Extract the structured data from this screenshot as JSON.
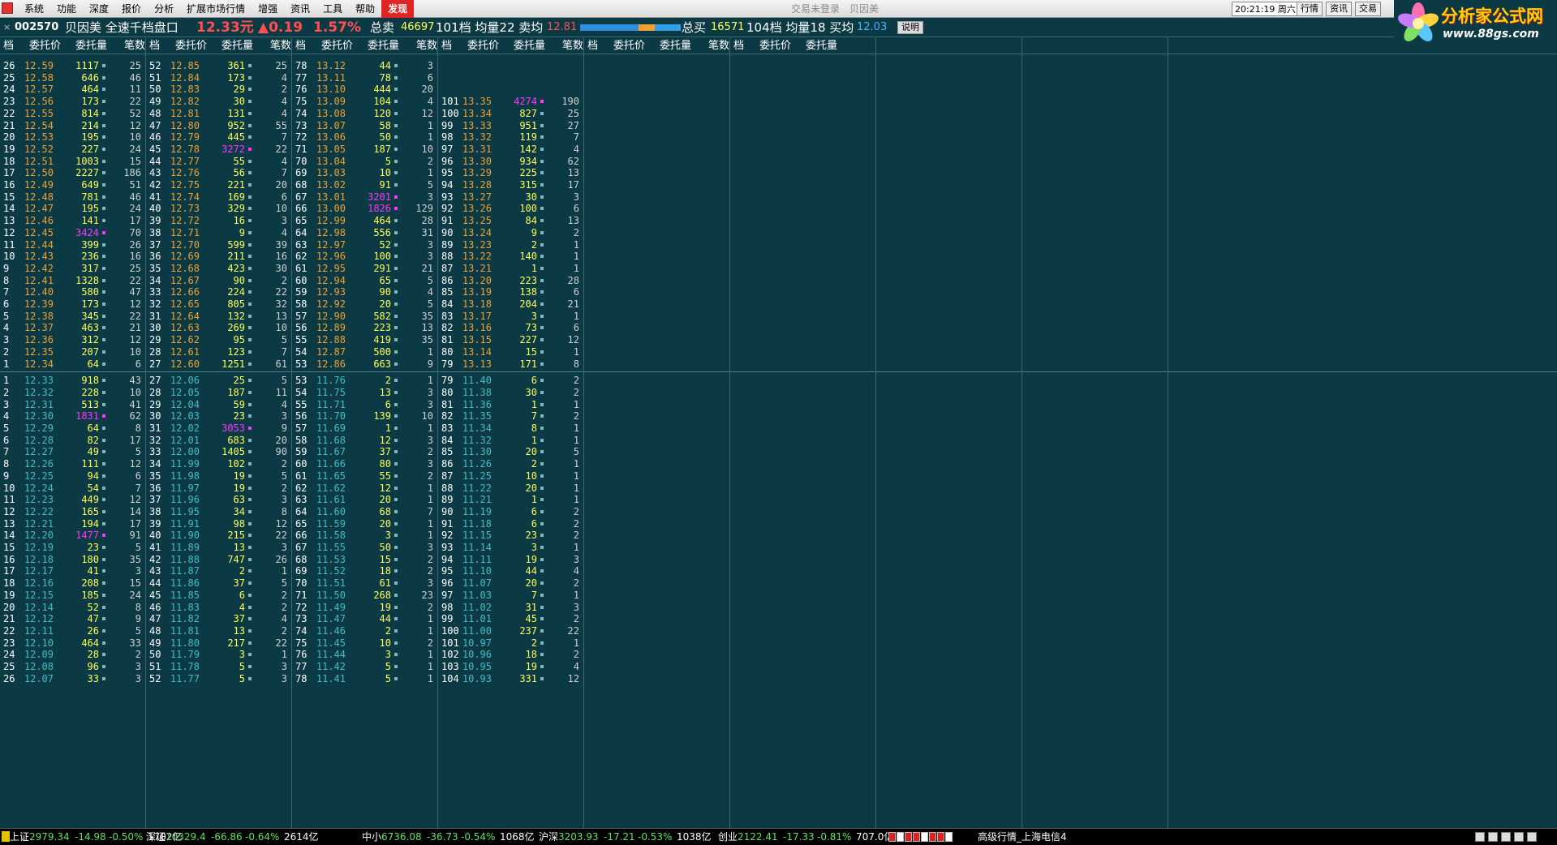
{
  "menu": {
    "items": [
      "系统",
      "功能",
      "深度",
      "报价",
      "分析",
      "扩展市场行情",
      "增强",
      "资讯",
      "工具",
      "帮助",
      "发现"
    ],
    "active_index": 10,
    "window_title": "交易未登录　贝因美",
    "clock": "20:21:19 周六",
    "right_buttons": [
      "行情",
      "资讯",
      "交易"
    ]
  },
  "logo": {
    "line1": "分析家公式网",
    "line2": "www.88gs.com"
  },
  "quote": {
    "close_mark": "×",
    "code": "002570",
    "title": "贝因美 全速千档盘口",
    "price": "12.33元",
    "change": "▲0.19",
    "pct": "1.57%",
    "sell_label": "总卖",
    "sell_total": "46697",
    "sell_rest": "101档 均量22 卖均",
    "sell_avg": "12.81",
    "buy_label": "总买",
    "buy_total": "16571",
    "buy_rest": "104档 均量18 买均",
    "buy_avg": "12.03",
    "help": "说明",
    "sell_fraction": 0.74
  },
  "column_headers": [
    "档",
    "委托价",
    "委托量",
    "笔数"
  ],
  "colors": {
    "ask": "#f0a030",
    "bid": "#3fbfc8",
    "vol": "#ffff55",
    "big": "#ff33ff",
    "white": "#ffffff",
    "grid": "#3a6a74"
  },
  "asks": {
    "col1": [
      [
        26,
        "12.59",
        "1117",
        "",
        25
      ],
      [
        25,
        "12.58",
        "646",
        "",
        46
      ],
      [
        24,
        "12.57",
        "464",
        "",
        11
      ],
      [
        23,
        "12.56",
        "173",
        "",
        22
      ],
      [
        22,
        "12.55",
        "814",
        "",
        52
      ],
      [
        21,
        "12.54",
        "214",
        "",
        12
      ],
      [
        20,
        "12.53",
        "195",
        "",
        10
      ],
      [
        19,
        "12.52",
        "227",
        "",
        24
      ],
      [
        18,
        "12.51",
        "1003",
        "",
        15
      ],
      [
        17,
        "12.50",
        "2227",
        "",
        186
      ],
      [
        16,
        "12.49",
        "649",
        "",
        51
      ],
      [
        15,
        "12.48",
        "781",
        "",
        46
      ],
      [
        14,
        "12.47",
        "195",
        "",
        24
      ],
      [
        13,
        "12.46",
        "141",
        "",
        17
      ],
      [
        12,
        "12.45",
        "3424",
        "big",
        70
      ],
      [
        11,
        "12.44",
        "399",
        "",
        26
      ],
      [
        10,
        "12.43",
        "236",
        "",
        16
      ],
      [
        9,
        "12.42",
        "317",
        "",
        25
      ],
      [
        8,
        "12.41",
        "1328",
        "",
        22
      ],
      [
        7,
        "12.40",
        "580",
        "",
        47
      ],
      [
        6,
        "12.39",
        "173",
        "",
        12
      ],
      [
        5,
        "12.38",
        "345",
        "",
        22
      ],
      [
        4,
        "12.37",
        "463",
        "",
        21
      ],
      [
        3,
        "12.36",
        "312",
        "",
        12
      ],
      [
        2,
        "12.35",
        "207",
        "",
        10
      ],
      [
        1,
        "12.34",
        "64",
        "",
        6
      ]
    ],
    "col2": [
      [
        52,
        "12.85",
        "361",
        "",
        25
      ],
      [
        51,
        "12.84",
        "173",
        "",
        4
      ],
      [
        50,
        "12.83",
        "29",
        "",
        2
      ],
      [
        49,
        "12.82",
        "30",
        "",
        4
      ],
      [
        48,
        "12.81",
        "131",
        "",
        4
      ],
      [
        47,
        "12.80",
        "952",
        "",
        55
      ],
      [
        46,
        "12.79",
        "445",
        "",
        7
      ],
      [
        45,
        "12.78",
        "3272",
        "big",
        22
      ],
      [
        44,
        "12.77",
        "55",
        "",
        4
      ],
      [
        43,
        "12.76",
        "56",
        "",
        7
      ],
      [
        42,
        "12.75",
        "221",
        "",
        20
      ],
      [
        41,
        "12.74",
        "169",
        "",
        6
      ],
      [
        40,
        "12.73",
        "329",
        "",
        10
      ],
      [
        39,
        "12.72",
        "16",
        "",
        3
      ],
      [
        38,
        "12.71",
        "9",
        "",
        4
      ],
      [
        37,
        "12.70",
        "599",
        "",
        39
      ],
      [
        36,
        "12.69",
        "211",
        "",
        16
      ],
      [
        35,
        "12.68",
        "423",
        "",
        30
      ],
      [
        34,
        "12.67",
        "90",
        "",
        2
      ],
      [
        33,
        "12.66",
        "224",
        "",
        22
      ],
      [
        32,
        "12.65",
        "805",
        "",
        32
      ],
      [
        31,
        "12.64",
        "132",
        "",
        13
      ],
      [
        30,
        "12.63",
        "269",
        "",
        10
      ],
      [
        29,
        "12.62",
        "95",
        "",
        5
      ],
      [
        28,
        "12.61",
        "123",
        "",
        7
      ],
      [
        27,
        "12.60",
        "1251",
        "",
        61
      ]
    ],
    "col3": [
      [
        78,
        "13.12",
        "44",
        "",
        3
      ],
      [
        77,
        "13.11",
        "78",
        "",
        6
      ],
      [
        76,
        "13.10",
        "444",
        "",
        20
      ],
      [
        75,
        "13.09",
        "104",
        "",
        4
      ],
      [
        74,
        "13.08",
        "120",
        "",
        12
      ],
      [
        73,
        "13.07",
        "58",
        "",
        1
      ],
      [
        72,
        "13.06",
        "50",
        "",
        1
      ],
      [
        71,
        "13.05",
        "187",
        "",
        10
      ],
      [
        70,
        "13.04",
        "5",
        "",
        2
      ],
      [
        69,
        "13.03",
        "10",
        "",
        1
      ],
      [
        68,
        "13.02",
        "91",
        "",
        5
      ],
      [
        67,
        "13.01",
        "3201",
        "big",
        3
      ],
      [
        66,
        "13.00",
        "1826",
        "big",
        129
      ],
      [
        65,
        "12.99",
        "464",
        "",
        28
      ],
      [
        64,
        "12.98",
        "556",
        "",
        31
      ],
      [
        63,
        "12.97",
        "52",
        "",
        3
      ],
      [
        62,
        "12.96",
        "100",
        "",
        3
      ],
      [
        61,
        "12.95",
        "291",
        "",
        21
      ],
      [
        60,
        "12.94",
        "65",
        "",
        5
      ],
      [
        59,
        "12.93",
        "90",
        "",
        4
      ],
      [
        58,
        "12.92",
        "20",
        "",
        5
      ],
      [
        57,
        "12.90",
        "582",
        "",
        35
      ],
      [
        56,
        "12.89",
        "223",
        "",
        13
      ],
      [
        55,
        "12.88",
        "419",
        "",
        35
      ],
      [
        54,
        "12.87",
        "500",
        "",
        1
      ],
      [
        53,
        "12.86",
        "663",
        "",
        9
      ]
    ],
    "col4": [
      [
        101,
        "13.35",
        "4274",
        "big",
        190
      ],
      [
        100,
        "13.34",
        "827",
        "",
        25
      ],
      [
        99,
        "13.33",
        "951",
        "",
        27
      ],
      [
        98,
        "13.32",
        "119",
        "",
        7
      ],
      [
        97,
        "13.31",
        "142",
        "",
        4
      ],
      [
        96,
        "13.30",
        "934",
        "",
        62
      ],
      [
        95,
        "13.29",
        "225",
        "",
        13
      ],
      [
        94,
        "13.28",
        "315",
        "",
        17
      ],
      [
        93,
        "13.27",
        "30",
        "",
        3
      ],
      [
        92,
        "13.26",
        "100",
        "",
        6
      ],
      [
        91,
        "13.25",
        "84",
        "",
        13
      ],
      [
        90,
        "13.24",
        "9",
        "",
        2
      ],
      [
        89,
        "13.23",
        "2",
        "",
        1
      ],
      [
        88,
        "13.22",
        "140",
        "",
        1
      ],
      [
        87,
        "13.21",
        "1",
        "",
        1
      ],
      [
        86,
        "13.20",
        "223",
        "",
        28
      ],
      [
        85,
        "13.19",
        "138",
        "",
        6
      ],
      [
        84,
        "13.18",
        "204",
        "",
        21
      ],
      [
        83,
        "13.17",
        "3",
        "",
        1
      ],
      [
        82,
        "13.16",
        "73",
        "",
        6
      ],
      [
        81,
        "13.15",
        "227",
        "",
        12
      ],
      [
        80,
        "13.14",
        "15",
        "",
        1
      ],
      [
        79,
        "13.13",
        "171",
        "",
        8
      ]
    ]
  },
  "bids": {
    "col1": [
      [
        1,
        "12.33",
        "918",
        "",
        43
      ],
      [
        2,
        "12.32",
        "228",
        "",
        10
      ],
      [
        3,
        "12.31",
        "513",
        "",
        41
      ],
      [
        4,
        "12.30",
        "1831",
        "big",
        62
      ],
      [
        5,
        "12.29",
        "64",
        "",
        8
      ],
      [
        6,
        "12.28",
        "82",
        "",
        17
      ],
      [
        7,
        "12.27",
        "49",
        "",
        5
      ],
      [
        8,
        "12.26",
        "111",
        "",
        12
      ],
      [
        9,
        "12.25",
        "94",
        "",
        6
      ],
      [
        10,
        "12.24",
        "54",
        "",
        7
      ],
      [
        11,
        "12.23",
        "449",
        "",
        12
      ],
      [
        12,
        "12.22",
        "165",
        "",
        14
      ],
      [
        13,
        "12.21",
        "194",
        "",
        17
      ],
      [
        14,
        "12.20",
        "1477",
        "big",
        91
      ],
      [
        15,
        "12.19",
        "23",
        "",
        5
      ],
      [
        16,
        "12.18",
        "180",
        "",
        35
      ],
      [
        17,
        "12.17",
        "41",
        "",
        3
      ],
      [
        18,
        "12.16",
        "208",
        "",
        15
      ],
      [
        19,
        "12.15",
        "185",
        "",
        24
      ],
      [
        20,
        "12.14",
        "52",
        "",
        8
      ],
      [
        21,
        "12.12",
        "47",
        "",
        9
      ],
      [
        22,
        "12.11",
        "26",
        "",
        5
      ],
      [
        23,
        "12.10",
        "464",
        "",
        33
      ],
      [
        24,
        "12.09",
        "28",
        "",
        2
      ],
      [
        25,
        "12.08",
        "96",
        "",
        3
      ],
      [
        26,
        "12.07",
        "33",
        "",
        3
      ]
    ],
    "col2": [
      [
        27,
        "12.06",
        "25",
        "",
        5
      ],
      [
        28,
        "12.05",
        "187",
        "",
        11
      ],
      [
        29,
        "12.04",
        "59",
        "",
        4
      ],
      [
        30,
        "12.03",
        "23",
        "",
        3
      ],
      [
        31,
        "12.02",
        "3053",
        "big",
        9
      ],
      [
        32,
        "12.01",
        "683",
        "",
        20
      ],
      [
        33,
        "12.00",
        "1405",
        "",
        90
      ],
      [
        34,
        "11.99",
        "102",
        "",
        2
      ],
      [
        35,
        "11.98",
        "19",
        "",
        5
      ],
      [
        36,
        "11.97",
        "19",
        "",
        2
      ],
      [
        37,
        "11.96",
        "63",
        "",
        3
      ],
      [
        38,
        "11.95",
        "34",
        "",
        8
      ],
      [
        39,
        "11.91",
        "98",
        "",
        12
      ],
      [
        40,
        "11.90",
        "215",
        "",
        22
      ],
      [
        41,
        "11.89",
        "13",
        "",
        3
      ],
      [
        42,
        "11.88",
        "747",
        "",
        26
      ],
      [
        43,
        "11.87",
        "2",
        "",
        1
      ],
      [
        44,
        "11.86",
        "37",
        "",
        5
      ],
      [
        45,
        "11.85",
        "6",
        "",
        2
      ],
      [
        46,
        "11.83",
        "4",
        "",
        2
      ],
      [
        47,
        "11.82",
        "37",
        "",
        4
      ],
      [
        48,
        "11.81",
        "13",
        "",
        2
      ],
      [
        49,
        "11.80",
        "217",
        "",
        22
      ],
      [
        50,
        "11.79",
        "3",
        "",
        1
      ],
      [
        51,
        "11.78",
        "5",
        "",
        3
      ],
      [
        52,
        "11.77",
        "5",
        "",
        3
      ]
    ],
    "col3": [
      [
        53,
        "11.76",
        "2",
        "",
        1
      ],
      [
        54,
        "11.75",
        "13",
        "",
        3
      ],
      [
        55,
        "11.71",
        "6",
        "",
        3
      ],
      [
        56,
        "11.70",
        "139",
        "",
        10
      ],
      [
        57,
        "11.69",
        "1",
        "",
        1
      ],
      [
        58,
        "11.68",
        "12",
        "",
        3
      ],
      [
        59,
        "11.67",
        "37",
        "",
        2
      ],
      [
        60,
        "11.66",
        "80",
        "",
        3
      ],
      [
        61,
        "11.65",
        "55",
        "",
        2
      ],
      [
        62,
        "11.62",
        "12",
        "",
        1
      ],
      [
        63,
        "11.61",
        "20",
        "",
        1
      ],
      [
        64,
        "11.60",
        "68",
        "",
        7
      ],
      [
        65,
        "11.59",
        "20",
        "",
        1
      ],
      [
        66,
        "11.58",
        "3",
        "",
        1
      ],
      [
        67,
        "11.55",
        "50",
        "",
        3
      ],
      [
        68,
        "11.53",
        "15",
        "",
        2
      ],
      [
        69,
        "11.52",
        "18",
        "",
        2
      ],
      [
        70,
        "11.51",
        "61",
        "",
        3
      ],
      [
        71,
        "11.50",
        "268",
        "",
        23
      ],
      [
        72,
        "11.49",
        "19",
        "",
        2
      ],
      [
        73,
        "11.47",
        "44",
        "",
        1
      ],
      [
        74,
        "11.46",
        "2",
        "",
        1
      ],
      [
        75,
        "11.45",
        "10",
        "",
        2
      ],
      [
        76,
        "11.44",
        "3",
        "",
        1
      ],
      [
        77,
        "11.42",
        "5",
        "",
        1
      ],
      [
        78,
        "11.41",
        "5",
        "",
        1
      ]
    ],
    "col4": [
      [
        79,
        "11.40",
        "6",
        "",
        2
      ],
      [
        80,
        "11.38",
        "30",
        "",
        2
      ],
      [
        81,
        "11.36",
        "1",
        "",
        1
      ],
      [
        82,
        "11.35",
        "7",
        "",
        2
      ],
      [
        83,
        "11.34",
        "8",
        "",
        1
      ],
      [
        84,
        "11.32",
        "1",
        "",
        1
      ],
      [
        85,
        "11.30",
        "20",
        "",
        5
      ],
      [
        86,
        "11.26",
        "2",
        "",
        1
      ],
      [
        87,
        "11.25",
        "10",
        "",
        1
      ],
      [
        88,
        "11.22",
        "20",
        "",
        1
      ],
      [
        89,
        "11.21",
        "1",
        "",
        1
      ],
      [
        90,
        "11.19",
        "6",
        "",
        2
      ],
      [
        91,
        "11.18",
        "6",
        "",
        2
      ],
      [
        92,
        "11.15",
        "23",
        "",
        2
      ],
      [
        93,
        "11.14",
        "3",
        "",
        1
      ],
      [
        94,
        "11.11",
        "19",
        "",
        3
      ],
      [
        95,
        "11.10",
        "44",
        "",
        4
      ],
      [
        96,
        "11.07",
        "20",
        "",
        2
      ],
      [
        97,
        "11.03",
        "7",
        "",
        1
      ],
      [
        98,
        "11.02",
        "31",
        "",
        3
      ],
      [
        99,
        "11.01",
        "45",
        "",
        2
      ],
      [
        100,
        "11.00",
        "237",
        "",
        22
      ],
      [
        101,
        "10.97",
        "2",
        "",
        1
      ],
      [
        102,
        "10.96",
        "18",
        "",
        2
      ],
      [
        103,
        "10.95",
        "19",
        "",
        4
      ],
      [
        104,
        "10.93",
        "331",
        "",
        12
      ]
    ]
  },
  "status": {
    "items": [
      {
        "name": "上证",
        "val": "2979.34",
        "chg": "-14.98",
        "pct": "-0.50%",
        "amt": "1702亿"
      },
      {
        "name": "深证",
        "val": "10329.4",
        "chg": "-66.86",
        "pct": "-0.64%",
        "amt": "2614亿"
      },
      {
        "name": "中小",
        "val": "6736.08",
        "chg": "-36.73",
        "pct": "-0.54%",
        "amt": "1068亿"
      },
      {
        "name": "沪深",
        "val": "3203.93",
        "chg": "-17.21",
        "pct": "-0.53%",
        "amt": "1038亿"
      },
      {
        "name": "创业",
        "val": "2122.41",
        "chg": "-17.33",
        "pct": "-0.81%",
        "amt": "707.0亿"
      }
    ],
    "server": "高级行情_上海电信4"
  }
}
